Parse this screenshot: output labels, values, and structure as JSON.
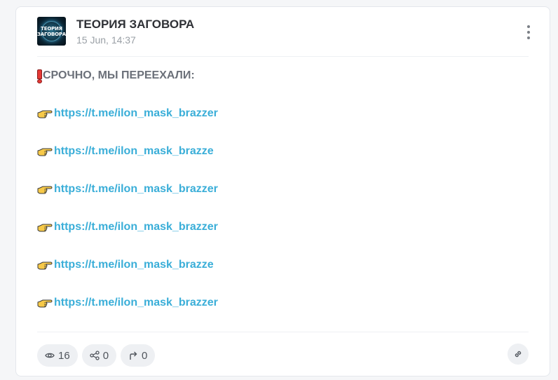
{
  "channel": {
    "title": "ТЕОРИЯ ЗАГОВОРА",
    "avatar_text": "ТЕОРИЯ\nЗАГОВОРА",
    "time": "15 Jun, 14:37"
  },
  "post": {
    "headline": "СРОЧНО, МЫ ПЕРЕЕХАЛИ:",
    "links": [
      "https://t.me/ilon_mask_brazzer",
      "https://t.me/ilon_mask_brazze",
      "https://t.me/ilon_mask_brazzer",
      "https://t.me/ilon_mask_brazzer",
      "https://t.me/ilon_mask_brazze",
      "https://t.me/ilon_mask_brazzer"
    ]
  },
  "stats": {
    "views": "16",
    "shares": "0",
    "forwards": "0"
  },
  "icons": {
    "menu": "more-vertical-icon",
    "headline": "exclamation-icon",
    "link_bullet": "pointing-hand-icon",
    "views": "eye-icon",
    "shares": "share-icon",
    "forwards": "forward-arrow-icon",
    "copy_link": "link-icon"
  },
  "colors": {
    "link": "#3aaed8",
    "headline": "#6b7079",
    "pill_bg": "#eef0f3"
  }
}
